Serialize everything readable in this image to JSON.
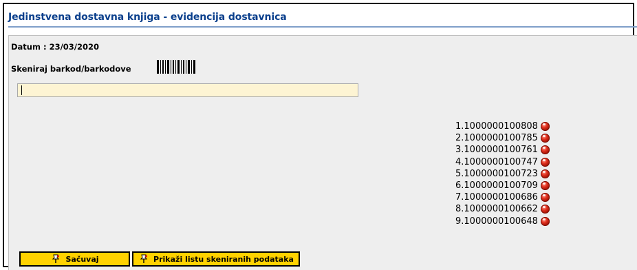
{
  "page": {
    "title": "Jedinstvena dostavna knjiga - evidencija dostavnica",
    "datum_label": "Datum : 23/03/2020",
    "scan_label": "Skeniraj barkod/barkodove",
    "scan_input_value": ""
  },
  "icons": {
    "barcode": "barcode-icon",
    "remove": "red-ball-icon",
    "button": "pin-icon"
  },
  "scanned_items": [
    "1.1000000100808",
    "2.1000000100785",
    "3.1000000100761",
    "4.1000000100747",
    "5.1000000100723",
    "6.1000000100709",
    "7.1000000100686",
    "8.1000000100662",
    "9.1000000100648"
  ],
  "buttons": {
    "save_label": "Sačuvaj",
    "show_list_label": "Prikaži listu skeniranih podataka"
  },
  "colors": {
    "title": "#0a3f8c",
    "panel_bg": "#eeeeee",
    "input_bg": "#fdf4d3",
    "button_bg": "#ffd200"
  }
}
